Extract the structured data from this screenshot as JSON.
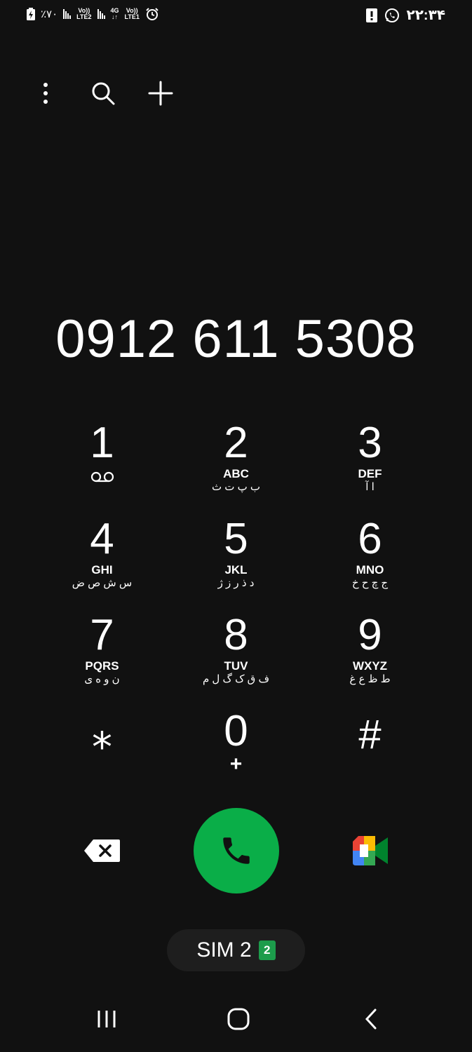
{
  "status_bar": {
    "battery": "٪۷۰",
    "sim2_net": [
      "Vo))",
      "LTE2"
    ],
    "sim1_gen": [
      "4G",
      "↓↑"
    ],
    "sim1_net": [
      "Vo))",
      "LTE1"
    ],
    "time": "۲۲:۳۴"
  },
  "dialer": {
    "number": "0912 611 5308",
    "keys": [
      {
        "digit": "1",
        "latin": "",
        "fa": ""
      },
      {
        "digit": "2",
        "latin": "ABC",
        "fa": "ب پ ت ث"
      },
      {
        "digit": "3",
        "latin": "DEF",
        "fa": "ا آ"
      },
      {
        "digit": "4",
        "latin": "GHI",
        "fa": "س ش ص ض"
      },
      {
        "digit": "5",
        "latin": "JKL",
        "fa": "د ذ ر ز ژ"
      },
      {
        "digit": "6",
        "latin": "MNO",
        "fa": "ج چ ح خ"
      },
      {
        "digit": "7",
        "latin": "PQRS",
        "fa": "ن و ه ی"
      },
      {
        "digit": "8",
        "latin": "TUV",
        "fa": "ف ق ک گ ل م"
      },
      {
        "digit": "9",
        "latin": "WXYZ",
        "fa": "ط ظ ع غ"
      },
      {
        "digit": "⁎",
        "latin": "",
        "fa": ""
      },
      {
        "digit": "0",
        "latin": "+",
        "fa": ""
      },
      {
        "digit": "#",
        "latin": "",
        "fa": ""
      }
    ],
    "sim_label": "SIM 2",
    "sim_badge": "2"
  },
  "colors": {
    "background": "#111111",
    "call_button": "#0aae48",
    "sim_badge": "#1c9c4b"
  }
}
